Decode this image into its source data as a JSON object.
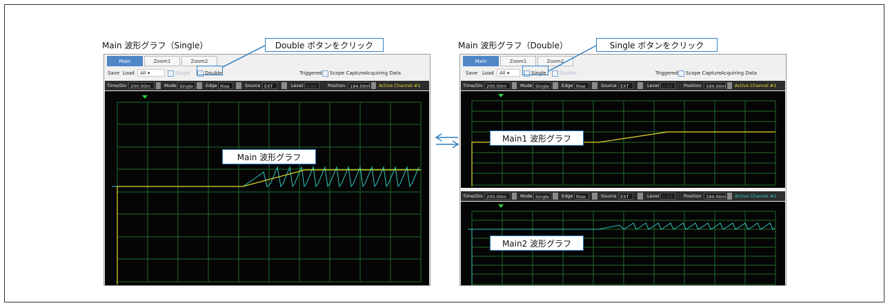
{
  "left_panel": {
    "title": "Main 波形グラフ（Single）",
    "tabs": [
      "Main",
      "Zoom1",
      "Zoom2"
    ],
    "toolbar": {
      "save": "Save",
      "load": "Load",
      "load_value": "All",
      "single": "Single",
      "double": "Double",
      "triggered": "Triggered",
      "scope_capture": "Scope Capture",
      "acquiring": "Acquiring Data"
    },
    "control": {
      "time_div_label": "Time/Div",
      "time_div_value": "200.00m",
      "mode_label": "Mode",
      "mode_value": "Single",
      "edge_label": "Edge",
      "edge_value": "Rise",
      "source_label": "Source",
      "source_value": "EXT",
      "level_label": "Level",
      "level_value": "0.00",
      "position_label": "Position",
      "position_value": "194.00m",
      "active_channel": "Active Channel #1"
    },
    "graph_label": "Main 波形グラフ",
    "callout": "Double ボタンをクリック"
  },
  "right_panel": {
    "title": "Main 波形グラフ（Double）",
    "tabs": [
      "Main",
      "Zoom1",
      "Zoom2"
    ],
    "toolbar": {
      "save": "Save",
      "load": "Load",
      "load_value": "All",
      "single": "Single",
      "double": "Double",
      "triggered": "Triggered",
      "scope_capture": "Scope Capture",
      "acquiring": "Acquiring Data"
    },
    "control1": {
      "time_div_label": "Time/Div",
      "time_div_value": "200.00m",
      "mode_label": "Mode",
      "mode_value": "Single",
      "edge_label": "Edge",
      "edge_value": "Rise",
      "source_label": "Source",
      "source_value": "EXT",
      "level_label": "Level",
      "level_value": "0.00",
      "position_label": "Position",
      "position_value": "194.00m",
      "active_channel": "Active Channel #1"
    },
    "control2": {
      "time_div_label": "Time/Div",
      "time_div_value": "200.00m",
      "mode_label": "Mode",
      "mode_value": "Single",
      "edge_label": "Edge",
      "edge_value": "Rise",
      "source_label": "Source",
      "source_value": "EXT",
      "level_label": "Level",
      "level_value": "0.00",
      "position_label": "Position",
      "position_value": "194.00m",
      "active_channel": "Active Channel #2"
    },
    "graph1_label": "Main1 波形グラフ",
    "graph2_label": "Main2 波形グラフ",
    "callout": "Single ボタンをクリック"
  },
  "colors": {
    "accent": "#2f7fc2",
    "grid": "#1f6e2a",
    "trace_yellow": "#e6dc2a",
    "trace_cyan": "#2ec9c2",
    "channel1": "#e6dc2a",
    "channel2": "#2ec9c2"
  }
}
